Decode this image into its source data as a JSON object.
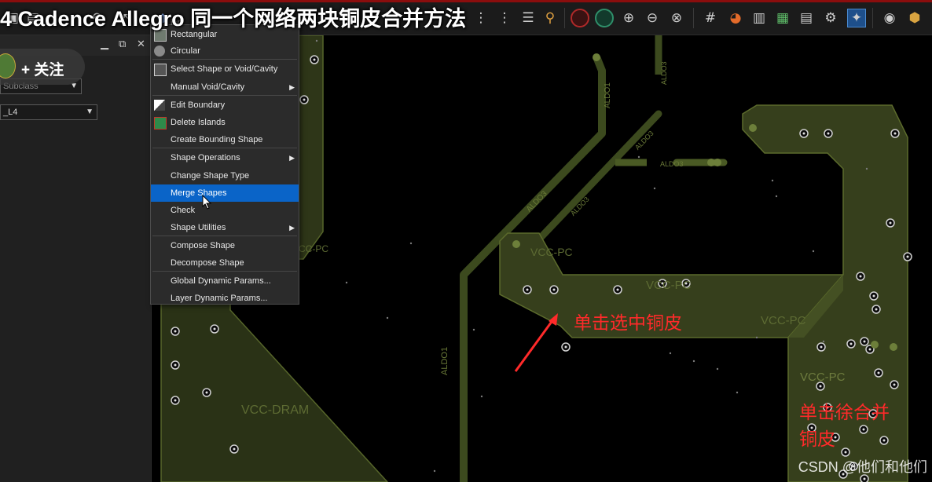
{
  "video": {
    "title": "4 Cadence Allegro 同一个网络两块铜皮合并方法",
    "follow_label": "+ 关注",
    "watermark": "CSDN @他们和他们"
  },
  "left_panel": {
    "subclass_placeholder": "Subclass",
    "layer_value": "_L4"
  },
  "context_menu": {
    "partial_top_label": "ion",
    "items": [
      {
        "label": "Rectangular",
        "icon": "rectangle-shape-icon",
        "submenu": false
      },
      {
        "label": "Circular",
        "icon": "circle-shape-icon",
        "submenu": false
      },
      {
        "label": "Select Shape or Void/Cavity",
        "icon": "select-shape-icon",
        "submenu": false
      },
      {
        "label": "Manual Void/Cavity",
        "icon": "",
        "submenu": true
      },
      {
        "label": "Edit Boundary",
        "icon": "edit-boundary-icon",
        "submenu": false
      },
      {
        "label": "Delete Islands",
        "icon": "delete-islands-icon",
        "submenu": false
      },
      {
        "label": "Create Bounding Shape",
        "icon": "",
        "submenu": false
      },
      {
        "label": "Shape Operations",
        "icon": "",
        "submenu": true
      },
      {
        "label": "Change Shape Type",
        "icon": "",
        "submenu": false
      },
      {
        "label": "Merge Shapes",
        "icon": "",
        "submenu": false,
        "highlighted": true
      },
      {
        "label": "Check",
        "icon": "",
        "submenu": false
      },
      {
        "label": "Shape Utilities",
        "icon": "",
        "submenu": true
      },
      {
        "label": "Compose Shape",
        "icon": "",
        "submenu": false
      },
      {
        "label": "Decompose Shape",
        "icon": "",
        "submenu": false
      },
      {
        "label": "Global Dynamic Params...",
        "icon": "",
        "submenu": false
      },
      {
        "label": "Layer Dynamic Params...",
        "icon": "",
        "submenu": false
      }
    ]
  },
  "canvas": {
    "net_labels": {
      "vcc_pc_a": "VCC-PC",
      "vcc_pc_b": "VCC-PC",
      "vcc_pc_c": "VCC-PC",
      "vcc_pc_d": "VCC-PC",
      "vcc_pc_e": "VCC-PC",
      "vcc_dram": "VCC-DRAM",
      "aldo1_a": "ALDO1",
      "aldo1_b": "ALDO1",
      "aldo3_a": "ALDO3",
      "aldo3_b": "ALDO3",
      "aldo3_c": "ALDO3",
      "aldo3_d": "ALDO3",
      "aldo3_e": "ALDO3"
    }
  },
  "annotations": {
    "select_copper": "单击选中铜皮",
    "merge_copper_line1": "单击徐合并",
    "merge_copper_line2": "铜皮"
  },
  "colors": {
    "copper_fill": "#363f1c",
    "copper_edge": "#5c6b2c",
    "trace": "#3c4a1e",
    "menu_highlight": "#0a64c8",
    "annotation": "#ff2a2a"
  }
}
